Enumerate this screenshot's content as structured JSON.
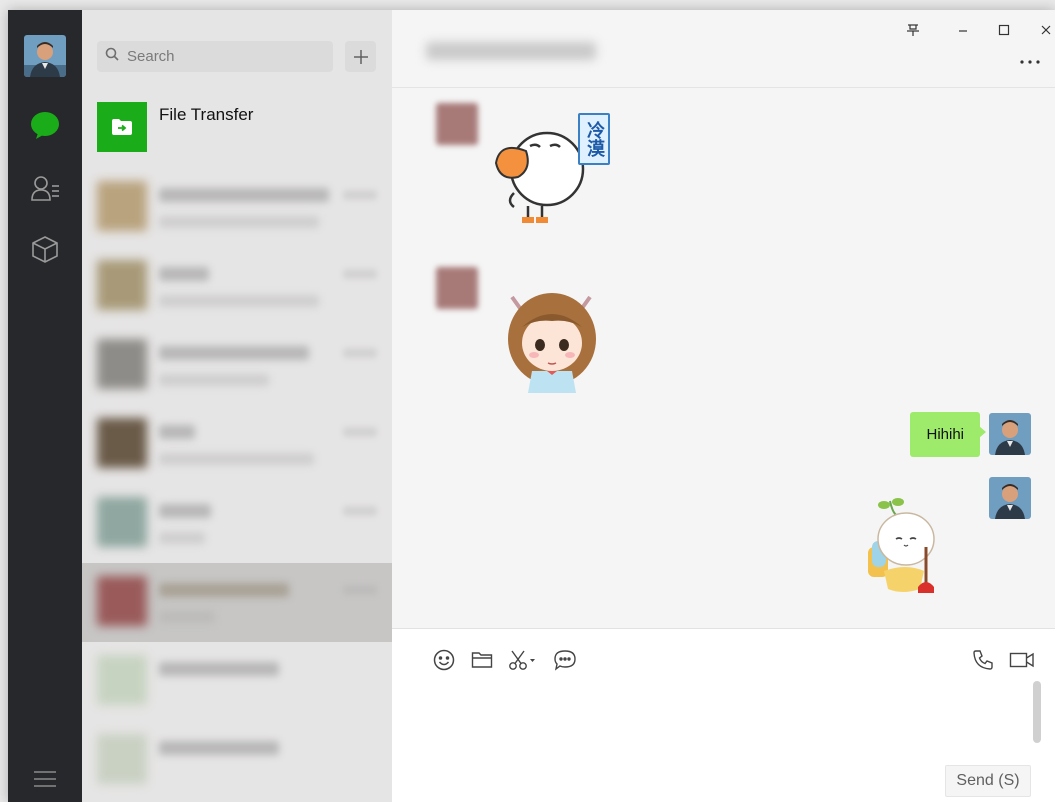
{
  "sidebar": {
    "user_avatar": "user-avatar",
    "icons": [
      "chat-icon",
      "contacts-icon",
      "favorites-cube-icon"
    ],
    "menu_icon": "menu-icon",
    "active_color": "#1aad19"
  },
  "chat_list": {
    "search_placeholder": "Search",
    "add_icon": "plus-icon",
    "items": [
      {
        "name": "File Transfer",
        "icon": "file-transfer-icon"
      }
    ]
  },
  "chat": {
    "header_icons": [
      "pin-icon",
      "minimize-icon",
      "maximize-icon",
      "close-icon",
      "more-icon"
    ],
    "messages": [
      {
        "from": "contact",
        "type": "sticker",
        "sticker": "duck",
        "text": "冷漠"
      },
      {
        "from": "contact",
        "type": "sticker",
        "sticker": "girl"
      },
      {
        "from": "me",
        "type": "text",
        "text": "Hihihi"
      },
      {
        "from": "me",
        "type": "sticker",
        "sticker": "toilet-sprout"
      }
    ],
    "bubble_color": "#9eea6a"
  },
  "composer": {
    "tools": [
      "emoji-icon",
      "folder-icon",
      "scissors-icon",
      "chat-history-icon"
    ],
    "call_icons": [
      "phone-icon",
      "video-icon"
    ],
    "send_label": "Send (S)"
  }
}
